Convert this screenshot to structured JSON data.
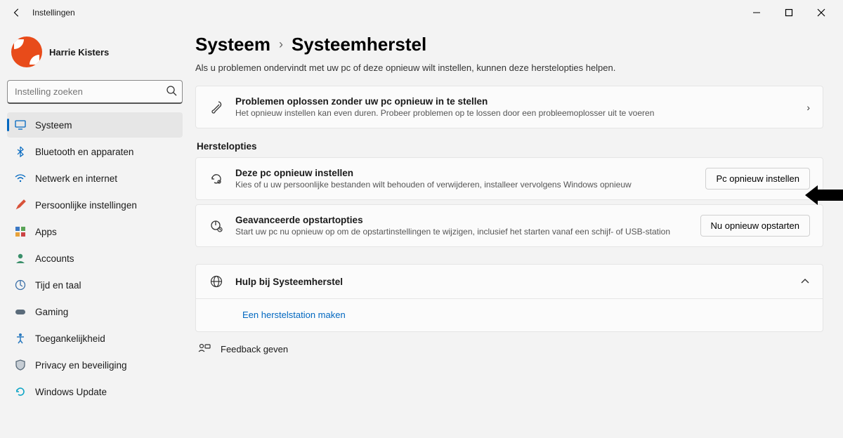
{
  "window": {
    "app_title": "Instellingen"
  },
  "profile": {
    "name": "Harrie Kisters"
  },
  "search": {
    "placeholder": "Instelling zoeken"
  },
  "nav": {
    "systeem": "Systeem",
    "bluetooth": "Bluetooth en apparaten",
    "netwerk": "Netwerk en internet",
    "persoonlijk": "Persoonlijke instellingen",
    "apps": "Apps",
    "accounts": "Accounts",
    "tijd": "Tijd en taal",
    "gaming": "Gaming",
    "toegankelijk": "Toegankelijkheid",
    "privacy": "Privacy en beveiliging",
    "update": "Windows Update"
  },
  "breadcrumb": {
    "root": "Systeem",
    "page": "Systeemherstel"
  },
  "subtitle": "Als u problemen ondervindt met uw pc of deze opnieuw wilt instellen, kunnen deze herstelopties helpen.",
  "trouble_card": {
    "title": "Problemen oplossen zonder uw pc opnieuw in te stellen",
    "desc": "Het opnieuw instellen kan even duren. Probeer problemen op te lossen door een probleemoplosser uit te voeren"
  },
  "section_herstel": "Herstelopties",
  "reset_card": {
    "title": "Deze pc opnieuw instellen",
    "desc": "Kies of u uw persoonlijke bestanden wilt behouden of verwijderen, installeer vervolgens Windows opnieuw",
    "button": "Pc opnieuw instellen"
  },
  "adv_card": {
    "title": "Geavanceerde opstartopties",
    "desc": "Start uw pc nu opnieuw op om de opstartinstellingen te wijzigen, inclusief het starten vanaf een schijf- of USB-station",
    "button": "Nu opnieuw opstarten"
  },
  "help": {
    "title": "Hulp bij Systeemherstel",
    "link1": "Een herstelstation maken"
  },
  "feedback": {
    "label": "Feedback geven"
  }
}
